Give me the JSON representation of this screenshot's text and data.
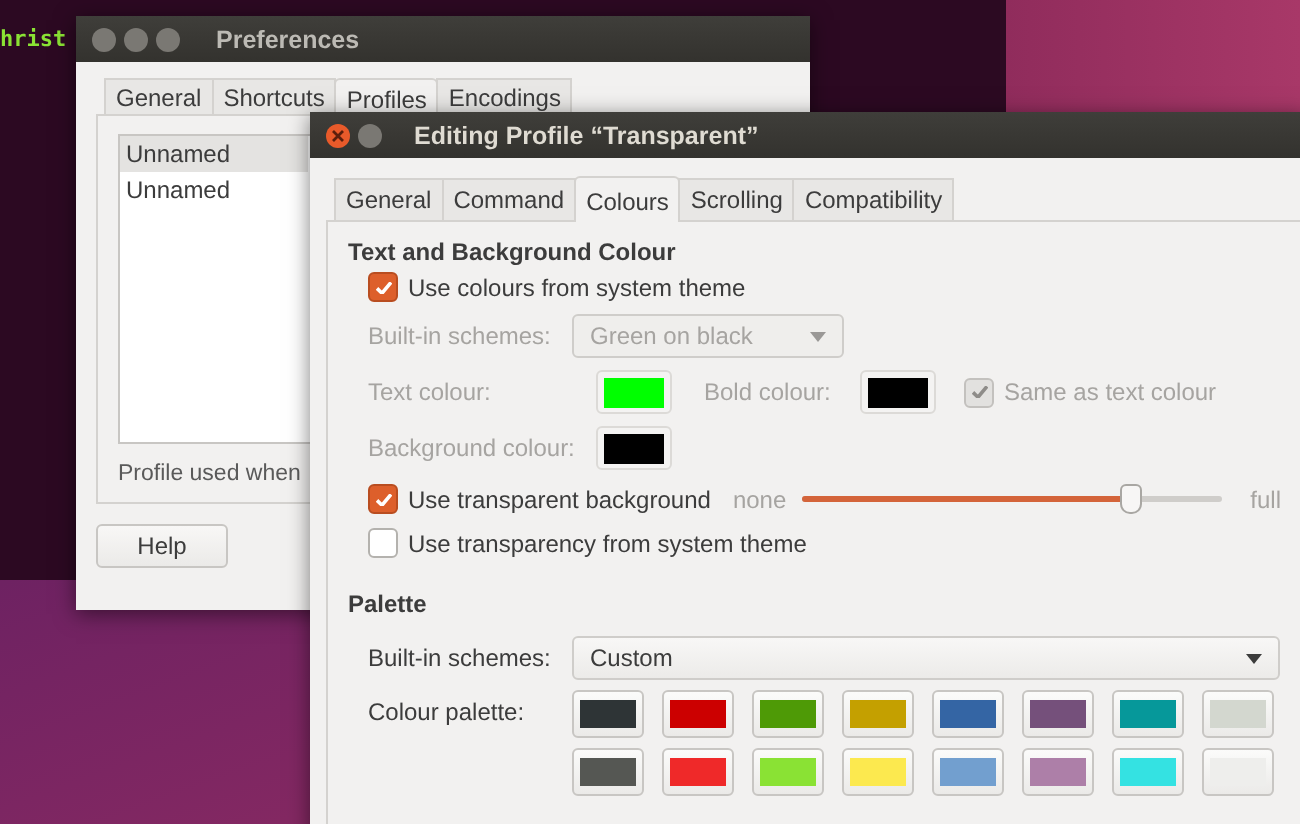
{
  "terminal": {
    "text": "hrist"
  },
  "preferences": {
    "title": "Preferences",
    "tabs": [
      {
        "label": "General",
        "selected": false
      },
      {
        "label": "Shortcuts",
        "selected": false
      },
      {
        "label": "Profiles",
        "selected": true
      },
      {
        "label": "Encodings",
        "selected": false
      }
    ],
    "profiles": [
      {
        "name": "Unnamed",
        "selected": true
      },
      {
        "name": "Unnamed",
        "selected": false
      }
    ],
    "profile_note": "Profile used when",
    "help_button": "Help"
  },
  "editor": {
    "title": "Editing Profile “Transparent”",
    "tabs": [
      {
        "label": "General",
        "selected": false
      },
      {
        "label": "Command",
        "selected": false
      },
      {
        "label": "Colours",
        "selected": true
      },
      {
        "label": "Scrolling",
        "selected": false
      },
      {
        "label": "Compatibility",
        "selected": false
      }
    ],
    "text_background": {
      "heading": "Text and Background Colour",
      "use_system_colours": {
        "label": "Use colours from system theme",
        "checked": true
      },
      "scheme": {
        "label": "Built-in schemes:",
        "value": "Green on black",
        "disabled": true
      },
      "text_colour": {
        "label": "Text colour:",
        "color": "#00ff00",
        "disabled": true
      },
      "bold_colour": {
        "label": "Bold colour:",
        "color": "#000000",
        "disabled": true
      },
      "same_as_text": {
        "label": "Same as text colour",
        "checked": true,
        "disabled": true
      },
      "background_colour": {
        "label": "Background colour:",
        "color": "#000000",
        "disabled": true
      },
      "transparent": {
        "label": "Use transparent background",
        "checked": true,
        "min_label": "none",
        "max_label": "full",
        "level": 0.78
      },
      "system_transparency": {
        "label": "Use transparency from system theme",
        "checked": false
      }
    },
    "palette": {
      "heading": "Palette",
      "scheme": {
        "label": "Built-in schemes:",
        "value": "Custom"
      },
      "palette_label": "Colour palette:",
      "rows": [
        {
          "swatches": [
            {
              "color": "#2e3436"
            },
            {
              "color": "#cc0000"
            },
            {
              "color": "#4e9a06"
            },
            {
              "color": "#c4a000"
            },
            {
              "color": "#3465a4"
            },
            {
              "color": "#75507b"
            },
            {
              "color": "#06989a"
            },
            {
              "color": "#d3d7cf"
            }
          ]
        },
        {
          "swatches": [
            {
              "color": "#555753"
            },
            {
              "color": "#ef2929"
            },
            {
              "color": "#8ae234"
            },
            {
              "color": "#fce94f"
            },
            {
              "color": "#729fcf"
            },
            {
              "color": "#ad7fa8"
            },
            {
              "color": "#34e2e2"
            },
            {
              "color": "#eeeeec"
            }
          ]
        }
      ]
    }
  }
}
